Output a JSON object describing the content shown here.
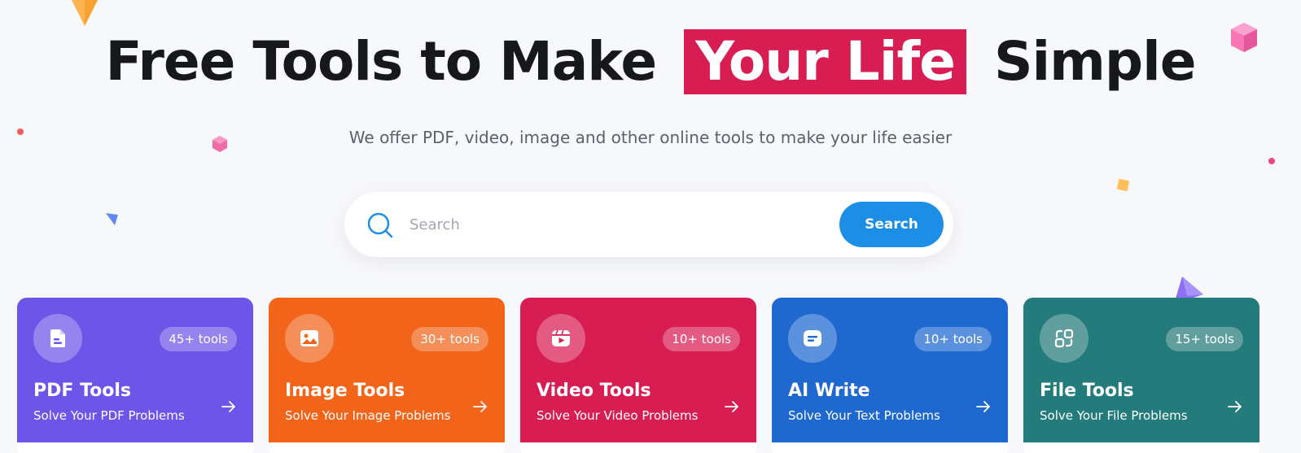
{
  "hero": {
    "title_before": "Free Tools to Make",
    "title_highlight": "Your Life",
    "title_after": "Simple",
    "subtitle": "We offer PDF, video, image and other online tools to make your life easier"
  },
  "search": {
    "placeholder": "Search",
    "button_label": "Search"
  },
  "cards": [
    {
      "title": "PDF Tools",
      "description": "Solve Your PDF Problems",
      "badge": "45+ tools",
      "color": "#6c55e8",
      "icon": "pdf-document-icon"
    },
    {
      "title": "Image Tools",
      "description": "Solve Your Image Problems",
      "badge": "30+ tools",
      "color": "#f26419",
      "icon": "image-icon"
    },
    {
      "title": "Video Tools",
      "description": "Solve Your Video Problems",
      "badge": "10+ tools",
      "color": "#d81d53",
      "icon": "video-play-icon"
    },
    {
      "title": "AI Write",
      "description": "Solve Your Text Problems",
      "badge": "10+ tools",
      "color": "#1e68d0",
      "icon": "chat-text-icon"
    },
    {
      "title": "File Tools",
      "description": "Solve Your File Problems",
      "badge": "15+ tools",
      "color": "#247b7b",
      "icon": "file-convert-icon"
    }
  ],
  "colors": {
    "accent_highlight": "#d81d53",
    "search_button": "#1c8ee6",
    "background": "#f7f8fb"
  }
}
